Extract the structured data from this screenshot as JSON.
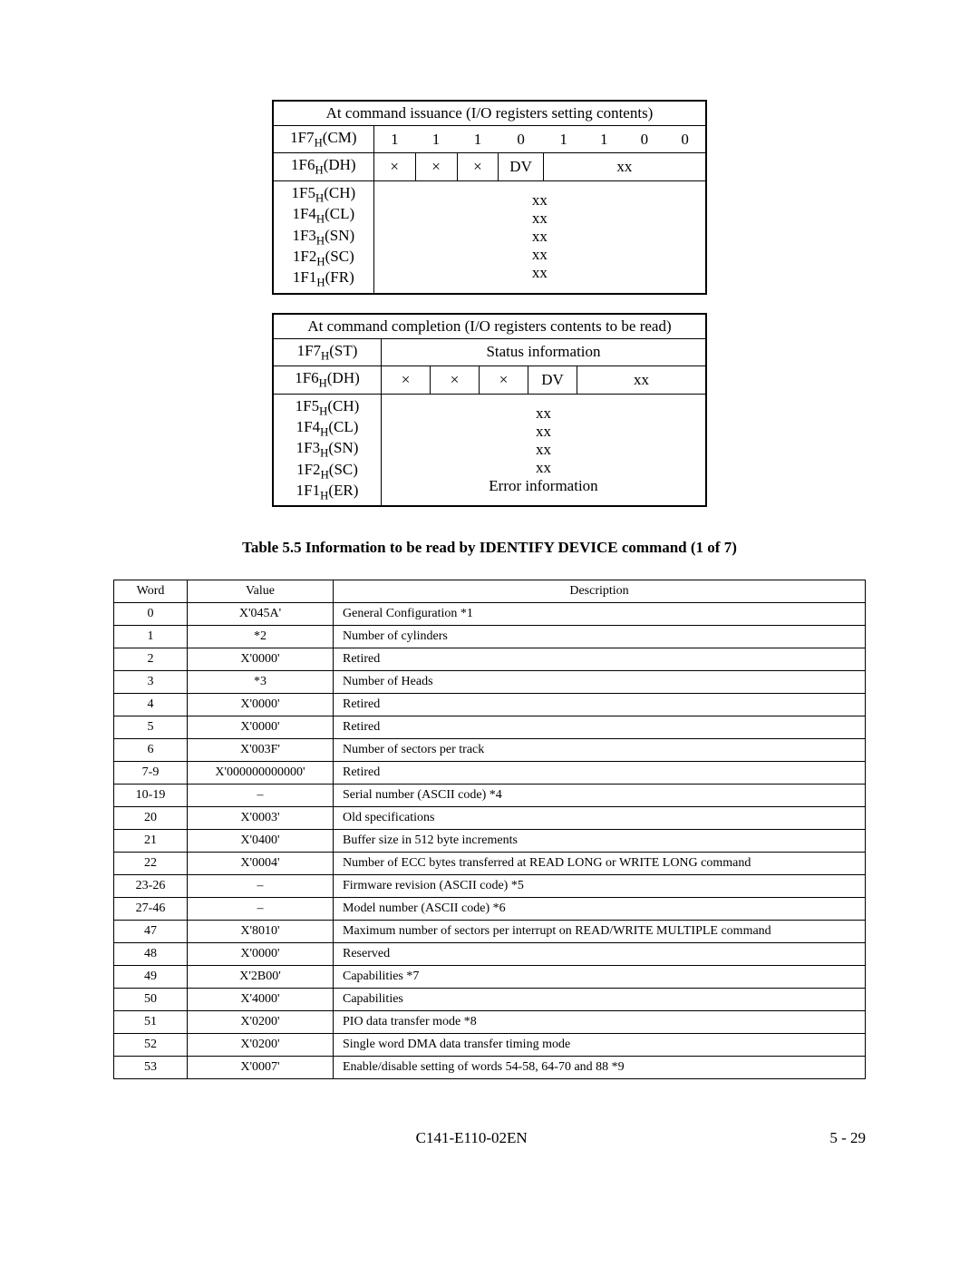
{
  "tableA": {
    "header": "At command issuance (I/O registers setting contents)",
    "row1": {
      "label": "1F7",
      "sub": "H",
      "paren": "(CM)",
      "bits": [
        "1",
        "1",
        "1",
        "0",
        "1",
        "1",
        "0",
        "0"
      ]
    },
    "row2": {
      "label": "1F6",
      "sub": "H",
      "paren": "(DH)",
      "c1": "×",
      "c2": "×",
      "c3": "×",
      "c4": "DV",
      "c5": "xx"
    },
    "block": {
      "l1": "1F5",
      "s1": "H",
      "p1": "(CH)",
      "v1": "xx",
      "l2": "1F4",
      "s2": "H",
      "p2": "(CL)",
      "v2": "xx",
      "l3": "1F3",
      "s3": "H",
      "p3": "(SN)",
      "v3": "xx",
      "l4": "1F2",
      "s4": "H",
      "p4": "(SC)",
      "v4": "xx",
      "l5": "1F1",
      "s5": "H",
      "p5": "(FR)",
      "v5": "xx"
    }
  },
  "tableB": {
    "header": "At command completion (I/O registers contents to be read)",
    "row1": {
      "label": "1F7",
      "sub": "H",
      "paren": "(ST)",
      "content": "Status information"
    },
    "row2": {
      "label": "1F6",
      "sub": "H",
      "paren": "(DH)",
      "c1": "×",
      "c2": "×",
      "c3": "×",
      "c4": "DV",
      "c5": "xx"
    },
    "block": {
      "l1": "1F5",
      "s1": "H",
      "p1": "(CH)",
      "v1": "xx",
      "l2": "1F4",
      "s2": "H",
      "p2": "(CL)",
      "v2": "xx",
      "l3": "1F3",
      "s3": "H",
      "p3": "(SN)",
      "v3": "xx",
      "l4": "1F2",
      "s4": "H",
      "p4": "(SC)",
      "v4": "xx",
      "l5": "1F1",
      "s5": "H",
      "p5": "(ER)",
      "v5": "Error information"
    }
  },
  "caption": "Table 5.5    Information to be read by IDENTIFY DEVICE command (1 of 7)",
  "data_headers": {
    "word": "Word",
    "value": "Value",
    "desc": "Description"
  },
  "rows": [
    {
      "word": "0",
      "value": "X'045A'",
      "desc": "General Configuration  *1"
    },
    {
      "word": "1",
      "value": "*2",
      "desc": "Number of cylinders"
    },
    {
      "word": "2",
      "value": "X'0000'",
      "desc": "Retired"
    },
    {
      "word": "3",
      "value": "*3",
      "desc": "Number of Heads"
    },
    {
      "word": "4",
      "value": "X'0000'",
      "desc": "Retired"
    },
    {
      "word": "5",
      "value": "X'0000'",
      "desc": "Retired"
    },
    {
      "word": "6",
      "value": "X'003F'",
      "desc": "Number of sectors per track"
    },
    {
      "word": "7-9",
      "value": "X'000000000000'",
      "desc": "Retired"
    },
    {
      "word": "10-19",
      "value": "–",
      "desc": "Serial number (ASCII code) *4"
    },
    {
      "word": "20",
      "value": "X'0003'",
      "desc": "Old specifications"
    },
    {
      "word": "21",
      "value": "X'0400'",
      "desc": "Buffer size in 512 byte increments"
    },
    {
      "word": "22",
      "value": "X'0004'",
      "desc": "Number of ECC bytes transferred at READ LONG or WRITE LONG command"
    },
    {
      "word": "23-26",
      "value": "–",
      "desc": "Firmware revision (ASCII code) *5"
    },
    {
      "word": "27-46",
      "value": "–",
      "desc": "Model number (ASCII code) *6"
    },
    {
      "word": "47",
      "value": "X'8010'",
      "desc": "Maximum number of sectors per interrupt on READ/WRITE MULTIPLE command"
    },
    {
      "word": "48",
      "value": "X'0000'",
      "desc": "Reserved"
    },
    {
      "word": "49",
      "value": "X'2B00'",
      "desc": "Capabilities *7"
    },
    {
      "word": "50",
      "value": "X'4000'",
      "desc": "Capabilities"
    },
    {
      "word": "51",
      "value": "X'0200'",
      "desc": "PIO data transfer mode *8"
    },
    {
      "word": "52",
      "value": "X'0200'",
      "desc": "Single word DMA data transfer timing mode"
    },
    {
      "word": "53",
      "value": "X'0007'",
      "desc": "Enable/disable setting of words 54-58, 64-70 and 88 *9"
    }
  ],
  "footer": {
    "doc": "C141-E110-02EN",
    "page": "5 - 29"
  }
}
